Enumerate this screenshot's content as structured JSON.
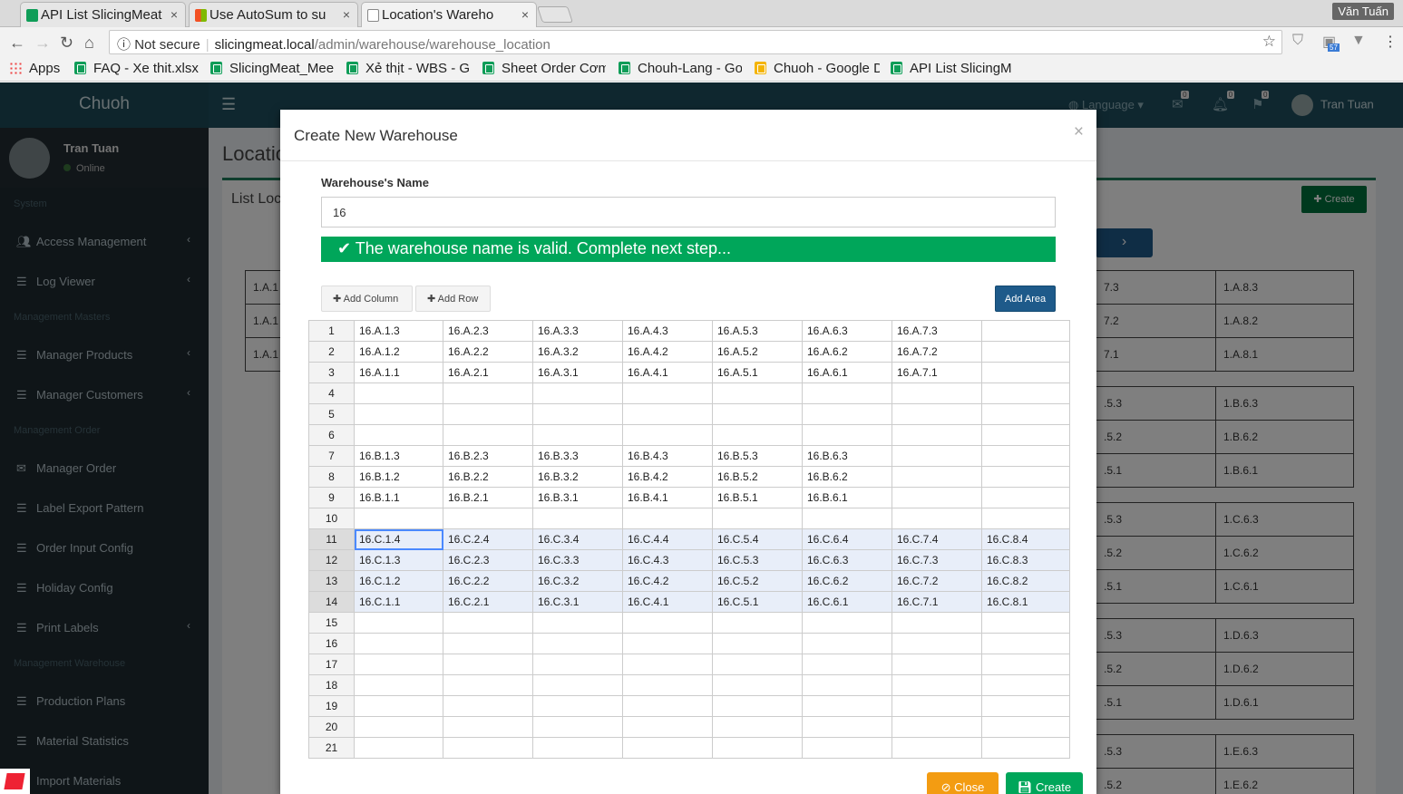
{
  "browser": {
    "tabs": [
      {
        "label": "API List SlicingMeat",
        "icon": "sheets-icon"
      },
      {
        "label": "Use AutoSum to su",
        "icon": "microsoft-icon"
      },
      {
        "label": "Location's Wareho",
        "icon": "page-icon"
      }
    ],
    "user_chip": "Văn Tuấn",
    "not_secure": "Not secure",
    "url_host": "slicingmeat.local",
    "url_path": "/admin/warehouse/warehouse_location",
    "extension_badge": "57",
    "bookmarks": [
      {
        "label": "Apps"
      },
      {
        "label": "FAQ - Xe thit.xlsx"
      },
      {
        "label": "SlicingMeat_Mee"
      },
      {
        "label": "Xẻ thịt - WBS - G"
      },
      {
        "label": "Sheet Order Cơm"
      },
      {
        "label": "Chouh-Lang - Go"
      },
      {
        "label": "Chuoh - Google D"
      },
      {
        "label": "API List SlicingM"
      }
    ]
  },
  "app": {
    "logo": "Chuoh",
    "language": "Language",
    "badges": [
      "0",
      "0",
      "0"
    ],
    "user_name": "Tran Tuan"
  },
  "sidebar": {
    "user_name": "Tran Tuan",
    "status": "Online",
    "sections": [
      "System",
      "Management Masters",
      "Management Order",
      "Management Warehouse"
    ],
    "items": [
      {
        "label": "Access Management"
      },
      {
        "label": "Log Viewer"
      },
      {
        "label": "Manager Products"
      },
      {
        "label": "Manager Customers"
      },
      {
        "label": "Manager Order"
      },
      {
        "label": "Label Export Pattern"
      },
      {
        "label": "Order Input Config"
      },
      {
        "label": "Holiday Config"
      },
      {
        "label": "Print Labels"
      },
      {
        "label": "Production Plans"
      },
      {
        "label": "Material Statistics"
      },
      {
        "label": "Import Materials"
      }
    ]
  },
  "content": {
    "title": "Locatio",
    "box_title": "List Loc",
    "create_label": "Create",
    "left_cells": [
      "1.A.1",
      "1.A.1",
      "1.A.1"
    ],
    "right_col1": [
      "7.3",
      "7.2",
      "7.1",
      "",
      ".5.3",
      ".5.2",
      ".5.1",
      "",
      ".5.3",
      ".5.2",
      ".5.1",
      "",
      ".5.3",
      ".5.2",
      ".5.1",
      "",
      ".5.3",
      ".5.2"
    ],
    "right_col2": [
      "1.A.8.3",
      "1.A.8.2",
      "1.A.8.1",
      "",
      "1.B.6.3",
      "1.B.6.2",
      "1.B.6.1",
      "",
      "1.C.6.3",
      "1.C.6.2",
      "1.C.6.1",
      "",
      "1.D.6.3",
      "1.D.6.2",
      "1.D.6.1",
      "",
      "1.E.6.3",
      "1.E.6.2"
    ]
  },
  "modal": {
    "title": "Create New Warehouse",
    "name_label": "Warehouse's Name",
    "name_value": "16",
    "valid_message": "The warehouse name is valid. Complete next step...",
    "add_column": "Add Column",
    "add_row": "Add Row",
    "add_area": "Add Area",
    "close": "Close",
    "create": "Create",
    "grid_rows": [
      [
        "16.A.1.3",
        "16.A.2.3",
        "16.A.3.3",
        "16.A.4.3",
        "16.A.5.3",
        "16.A.6.3",
        "16.A.7.3",
        ""
      ],
      [
        "16.A.1.2",
        "16.A.2.2",
        "16.A.3.2",
        "16.A.4.2",
        "16.A.5.2",
        "16.A.6.2",
        "16.A.7.2",
        ""
      ],
      [
        "16.A.1.1",
        "16.A.2.1",
        "16.A.3.1",
        "16.A.4.1",
        "16.A.5.1",
        "16.A.6.1",
        "16.A.7.1",
        ""
      ],
      [
        "",
        "",
        "",
        "",
        "",
        "",
        "",
        ""
      ],
      [
        "",
        "",
        "",
        "",
        "",
        "",
        "",
        ""
      ],
      [
        "",
        "",
        "",
        "",
        "",
        "",
        "",
        ""
      ],
      [
        "16.B.1.3",
        "16.B.2.3",
        "16.B.3.3",
        "16.B.4.3",
        "16.B.5.3",
        "16.B.6.3",
        "",
        ""
      ],
      [
        "16.B.1.2",
        "16.B.2.2",
        "16.B.3.2",
        "16.B.4.2",
        "16.B.5.2",
        "16.B.6.2",
        "",
        ""
      ],
      [
        "16.B.1.1",
        "16.B.2.1",
        "16.B.3.1",
        "16.B.4.1",
        "16.B.5.1",
        "16.B.6.1",
        "",
        ""
      ],
      [
        "",
        "",
        "",
        "",
        "",
        "",
        "",
        ""
      ],
      [
        "16.C.1.4",
        "16.C.2.4",
        "16.C.3.4",
        "16.C.4.4",
        "16.C.5.4",
        "16.C.6.4",
        "16.C.7.4",
        "16.C.8.4"
      ],
      [
        "16.C.1.3",
        "16.C.2.3",
        "16.C.3.3",
        "16.C.4.3",
        "16.C.5.3",
        "16.C.6.3",
        "16.C.7.3",
        "16.C.8.3"
      ],
      [
        "16.C.1.2",
        "16.C.2.2",
        "16.C.3.2",
        "16.C.4.2",
        "16.C.5.2",
        "16.C.6.2",
        "16.C.7.2",
        "16.C.8.2"
      ],
      [
        "16.C.1.1",
        "16.C.2.1",
        "16.C.3.1",
        "16.C.4.1",
        "16.C.5.1",
        "16.C.6.1",
        "16.C.7.1",
        "16.C.8.1"
      ],
      [
        "",
        "",
        "",
        "",
        "",
        "",
        "",
        ""
      ],
      [
        "",
        "",
        "",
        "",
        "",
        "",
        "",
        ""
      ],
      [
        "",
        "",
        "",
        "",
        "",
        "",
        "",
        ""
      ],
      [
        "",
        "",
        "",
        "",
        "",
        "",
        "",
        ""
      ],
      [
        "",
        "",
        "",
        "",
        "",
        "",
        "",
        ""
      ],
      [
        "",
        "",
        "",
        "",
        "",
        "",
        "",
        ""
      ],
      [
        "",
        "",
        "",
        "",
        "",
        "",
        "",
        ""
      ]
    ],
    "selected_rows": [
      11,
      12,
      13,
      14
    ]
  }
}
